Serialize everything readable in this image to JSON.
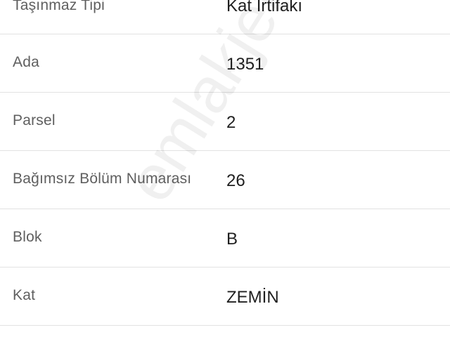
{
  "rows": [
    {
      "label": "Taşınmaz Tipi",
      "value": "Kat İrtifakı"
    },
    {
      "label": "Ada",
      "value": "1351"
    },
    {
      "label": "Parsel",
      "value": "2"
    },
    {
      "label": "Bağımsız Bölüm Numarası",
      "value": "26"
    },
    {
      "label": "Blok",
      "value": "B"
    },
    {
      "label": "Kat",
      "value": "ZEMİN"
    }
  ],
  "watermark": "emlakjet.com"
}
